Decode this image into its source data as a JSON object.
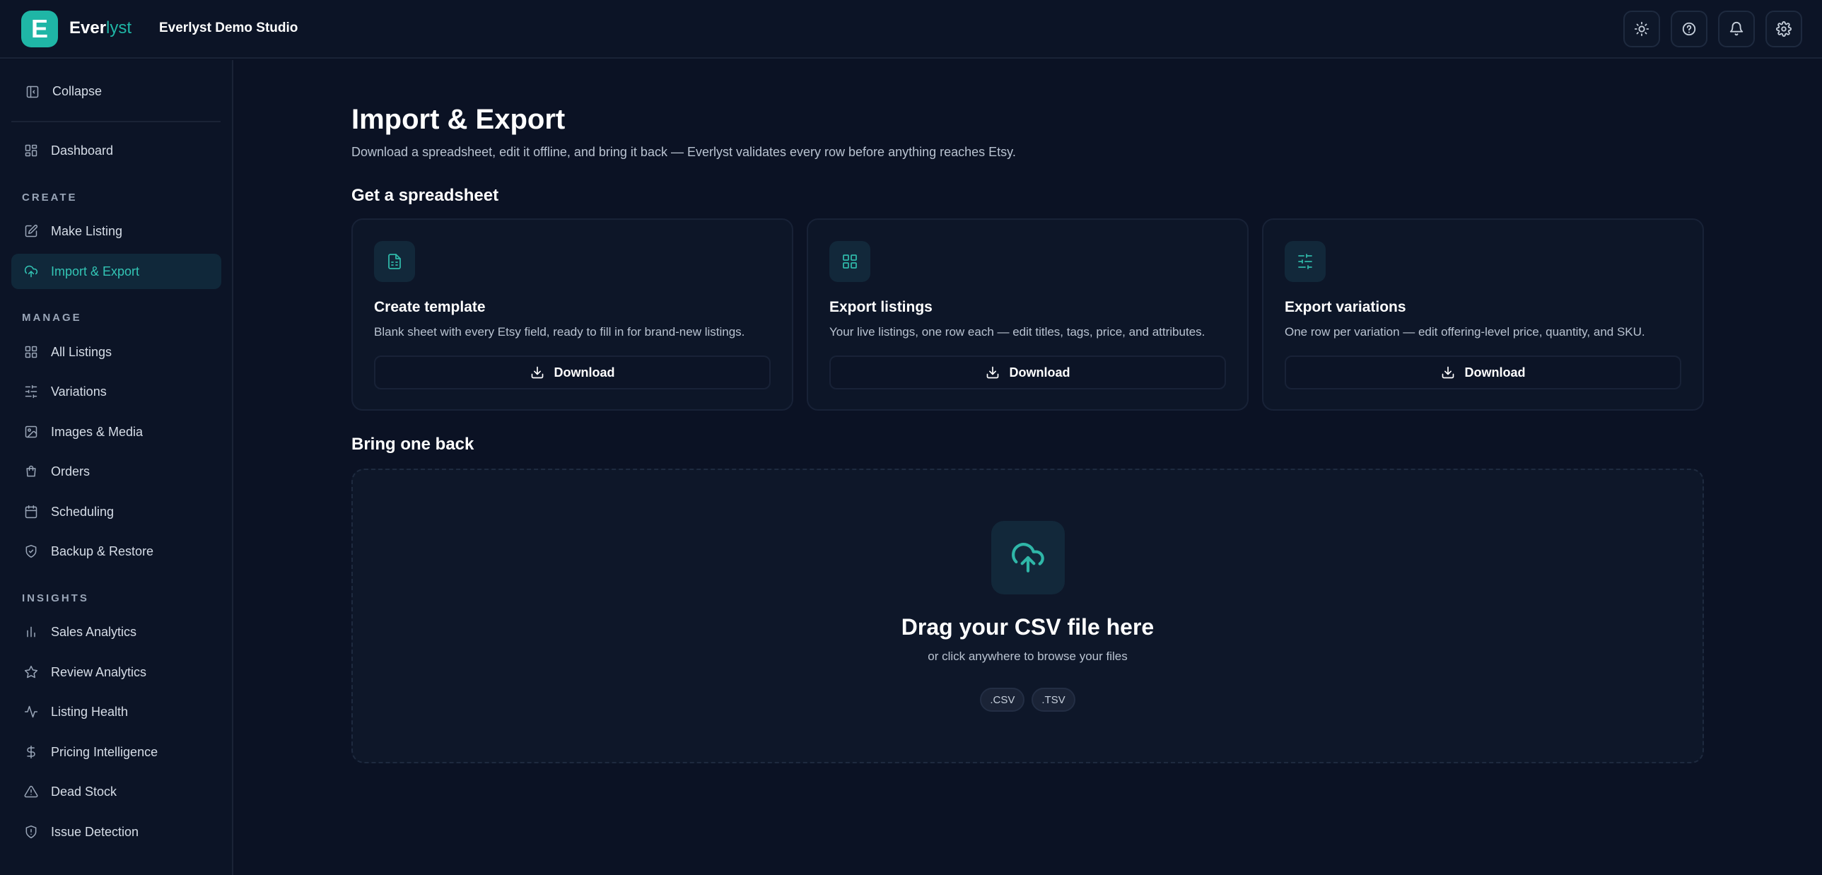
{
  "header": {
    "logo_letter": "E",
    "brand_main": "Ever",
    "brand_accent": "lyst",
    "studio_name": "Everlyst Demo Studio",
    "actions": [
      "sun-icon",
      "help-icon",
      "bell-icon",
      "gear-icon"
    ]
  },
  "sidebar": {
    "collapse_label": "Collapse",
    "dashboard_label": "Dashboard",
    "sections": {
      "create": "CREATE",
      "manage": "MANAGE",
      "insights": "INSIGHTS"
    },
    "items": {
      "make_listing": "Make Listing",
      "import_export": "Import & Export",
      "all_listings": "All Listings",
      "variations": "Variations",
      "images_media": "Images & Media",
      "orders": "Orders",
      "scheduling": "Scheduling",
      "backup_restore": "Backup & Restore",
      "sales_analytics": "Sales Analytics",
      "review_analytics": "Review Analytics",
      "listing_health": "Listing Health",
      "pricing_intelligence": "Pricing Intelligence",
      "dead_stock": "Dead Stock",
      "issue_detection": "Issue Detection"
    },
    "active_item": "import_export"
  },
  "main": {
    "title": "Import & Export",
    "subtitle": "Download a spreadsheet, edit it offline, and bring it back — Everlyst validates every row before anything reaches Etsy.",
    "get_section_title": "Get a spreadsheet",
    "cards": [
      {
        "title": "Create template",
        "description": "Blank sheet with every Etsy field, ready to fill in for brand-new listings.",
        "button": "Download",
        "icon": "document-icon"
      },
      {
        "title": "Export listings",
        "description": "Your live listings, one row each — edit titles, tags, price, and attributes.",
        "button": "Download",
        "icon": "grid-icon"
      },
      {
        "title": "Export variations",
        "description": "One row per variation — edit offering-level price, quantity, and SKU.",
        "button": "Download",
        "icon": "sliders-icon"
      }
    ],
    "bring_section_title": "Bring one back",
    "dropzone": {
      "title": "Drag your CSV file here",
      "subtitle": "or click anywhere to browse your files",
      "formats": [
        ".CSV",
        ".TSV"
      ]
    }
  },
  "colors": {
    "background": "#0b1224",
    "accent": "#1fb6a6",
    "active_nav_bg": "#10283a"
  }
}
